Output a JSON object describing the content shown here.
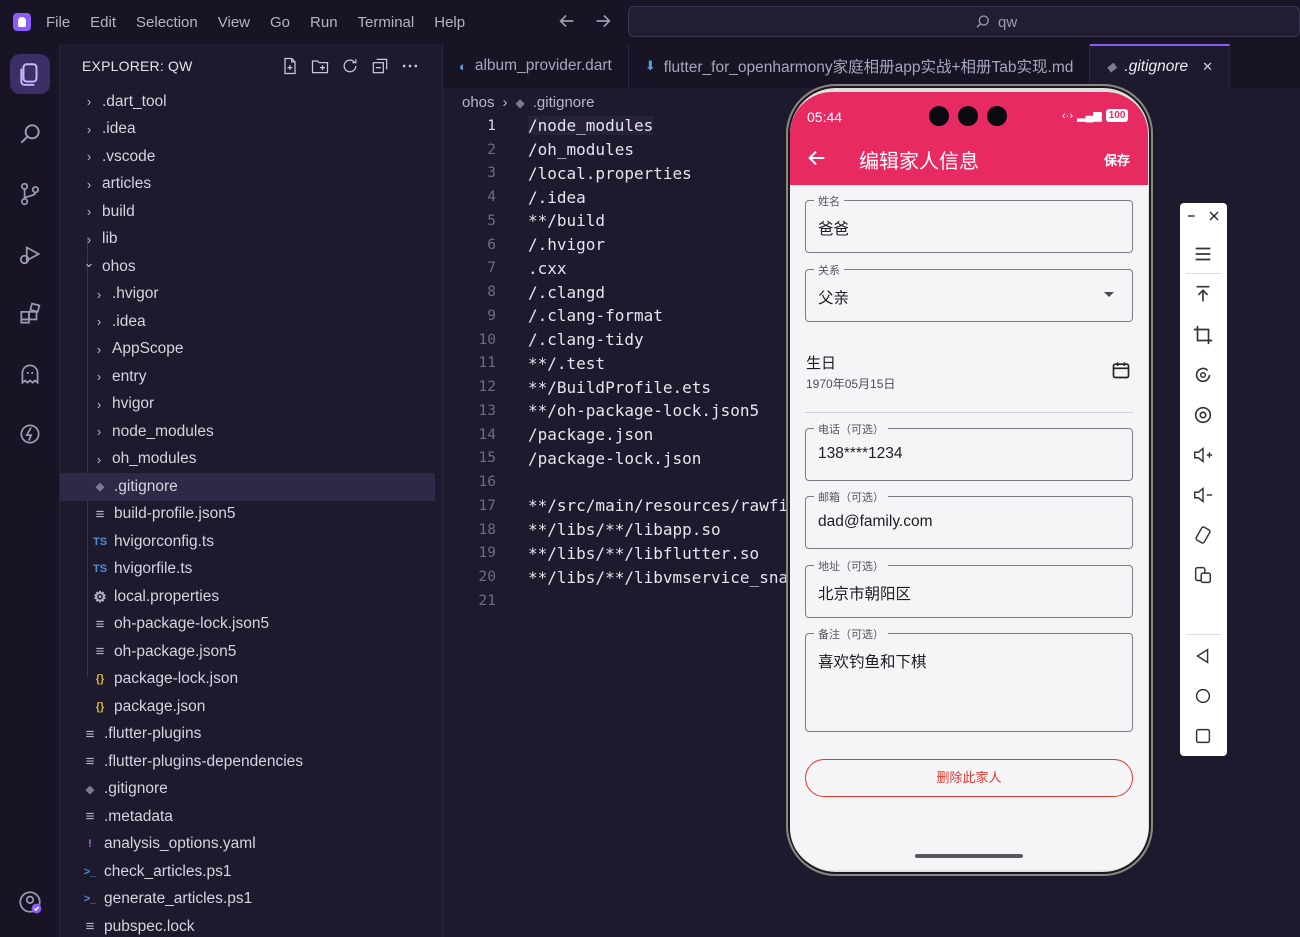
{
  "menu": [
    "File",
    "Edit",
    "Selection",
    "View",
    "Go",
    "Run",
    "Terminal",
    "Help"
  ],
  "search": {
    "text": "qw"
  },
  "explorer": {
    "title": "EXPLORER: QW",
    "items": [
      {
        "label": ".dart_tool",
        "type": "folder",
        "depth": 0,
        "open": false
      },
      {
        "label": ".idea",
        "type": "folder",
        "depth": 0,
        "open": false
      },
      {
        "label": ".vscode",
        "type": "folder",
        "depth": 0,
        "open": false
      },
      {
        "label": "articles",
        "type": "folder",
        "depth": 0,
        "open": false
      },
      {
        "label": "build",
        "type": "folder",
        "depth": 0,
        "open": false
      },
      {
        "label": "lib",
        "type": "folder",
        "depth": 0,
        "open": false
      },
      {
        "label": "ohos",
        "type": "folder",
        "depth": 0,
        "open": true
      },
      {
        "label": ".hvigor",
        "type": "folder",
        "depth": 1,
        "open": false
      },
      {
        "label": ".idea",
        "type": "folder",
        "depth": 1,
        "open": false
      },
      {
        "label": "AppScope",
        "type": "folder",
        "depth": 1,
        "open": false
      },
      {
        "label": "entry",
        "type": "folder",
        "depth": 1,
        "open": false
      },
      {
        "label": "hvigor",
        "type": "folder",
        "depth": 1,
        "open": false
      },
      {
        "label": "node_modules",
        "type": "folder",
        "depth": 1,
        "open": false
      },
      {
        "label": "oh_modules",
        "type": "folder",
        "depth": 1,
        "open": false
      },
      {
        "label": ".gitignore",
        "type": "git",
        "depth": 1,
        "selected": true
      },
      {
        "label": "build-profile.json5",
        "type": "lines",
        "depth": 1
      },
      {
        "label": "hvigorconfig.ts",
        "type": "ts",
        "depth": 1
      },
      {
        "label": "hvigorfile.ts",
        "type": "ts",
        "depth": 1
      },
      {
        "label": "local.properties",
        "type": "gear",
        "depth": 1
      },
      {
        "label": "oh-package-lock.json5",
        "type": "lines",
        "depth": 1
      },
      {
        "label": "oh-package.json5",
        "type": "lines",
        "depth": 1
      },
      {
        "label": "package-lock.json",
        "type": "json",
        "depth": 1
      },
      {
        "label": "package.json",
        "type": "json",
        "depth": 1
      },
      {
        "label": ".flutter-plugins",
        "type": "lines",
        "depth": 0
      },
      {
        "label": ".flutter-plugins-dependencies",
        "type": "lines",
        "depth": 0
      },
      {
        "label": ".gitignore",
        "type": "git",
        "depth": 0
      },
      {
        "label": ".metadata",
        "type": "lines",
        "depth": 0
      },
      {
        "label": "analysis_options.yaml",
        "type": "yaml",
        "depth": 0
      },
      {
        "label": "check_articles.ps1",
        "type": "ps",
        "depth": 0
      },
      {
        "label": "generate_articles.ps1",
        "type": "ps",
        "depth": 0
      },
      {
        "label": "pubspec.lock",
        "type": "lines",
        "depth": 0
      }
    ]
  },
  "tabs": [
    {
      "label": "album_provider.dart",
      "icon": "dart-icon"
    },
    {
      "label": "flutter_for_openharmony家庭相册app实战+相册Tab实现.md",
      "icon": "markdown-icon"
    },
    {
      "label": ".gitignore",
      "icon": "git-icon",
      "active": true
    }
  ],
  "breadcrumb": {
    "folder": "ohos",
    "file": ".gitignore"
  },
  "code_lines": [
    "/node_modules",
    "/oh_modules",
    "/local.properties",
    "/.idea",
    "**/build",
    "/.hvigor",
    ".cxx",
    "/.clangd",
    "/.clang-format",
    "/.clang-tidy",
    "**/.test",
    "**/BuildProfile.ets",
    "**/oh-package-lock.json5",
    "/package.json",
    "/package-lock.json",
    "",
    "**/src/main/resources/rawfi",
    "**/libs/**/libapp.so",
    "**/libs/**/libflutter.so",
    "**/libs/**/libvmservice_sna",
    ""
  ],
  "phone": {
    "status_time": "05:44",
    "battery": "100",
    "title": "编辑家人信息",
    "save": "保存",
    "fields": {
      "name": {
        "label": "姓名",
        "value": "爸爸"
      },
      "relation": {
        "label": "关系",
        "value": "父亲"
      },
      "phone": {
        "label": "电话（可选）",
        "value": "138****1234"
      },
      "email": {
        "label": "邮箱（可选）",
        "value": "dad@family.com"
      },
      "address": {
        "label": "地址（可选）",
        "value": "北京市朝阳区"
      },
      "note": {
        "label": "备注（可选）",
        "value": "喜欢钓鱼和下棋"
      }
    },
    "birthday": {
      "label": "生日",
      "value": "1970年05月15日"
    },
    "delete": "删除此家人"
  },
  "colors": {
    "accent": "#8b5cf6",
    "appbar": "#e82a63",
    "danger": "#e5392f"
  }
}
